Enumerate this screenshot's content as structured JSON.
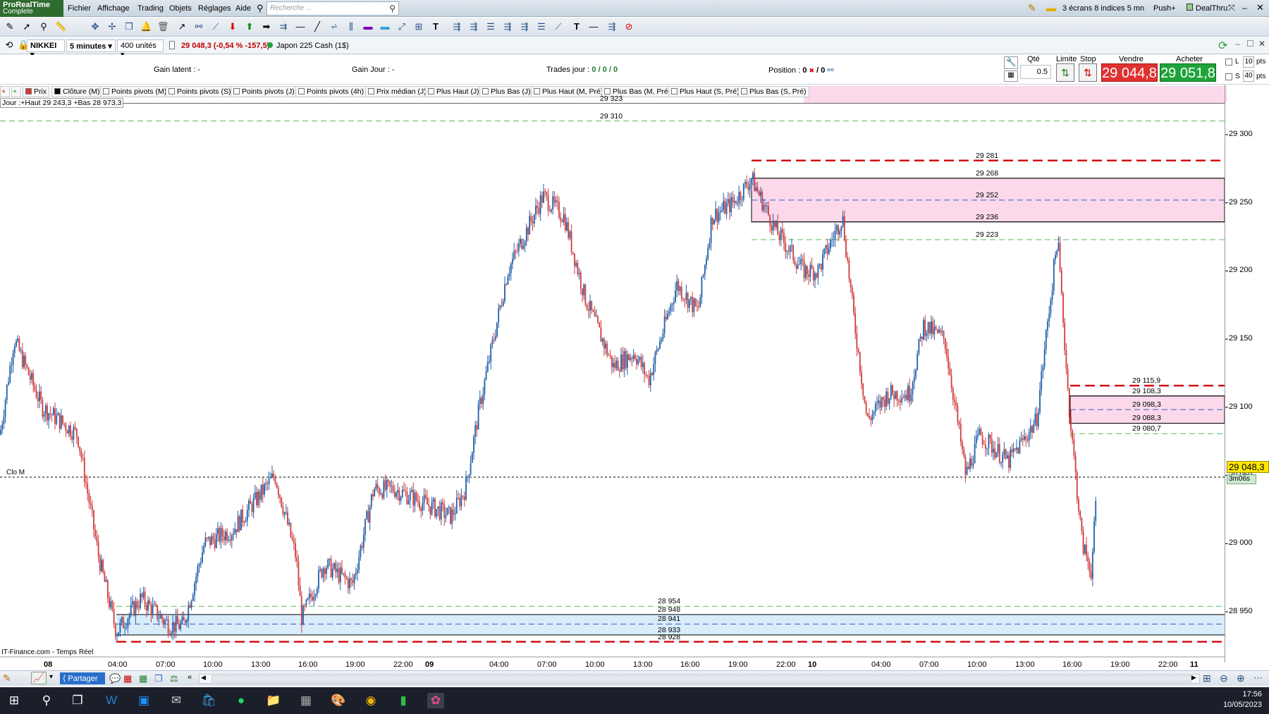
{
  "app": {
    "brand_line1": "ProRealTime",
    "brand_line2": "Complete"
  },
  "menu": [
    "Fichier",
    "Affichage",
    "Trading",
    "Objets",
    "Réglages",
    "Aide"
  ],
  "search": {
    "placeholder": "Recherche ..."
  },
  "top_right": {
    "layout": "3 écrans 8 indices 5 mn",
    "push": "Push+",
    "broker": "DealThru"
  },
  "instrument": {
    "symbol": "NIKKEI",
    "interval": "5 minutes",
    "units": "400 unités",
    "quote": "29 048,3 (-0,54 % -157,5)",
    "market": "Japon 225 Cash (1$)"
  },
  "info": {
    "gain_latent_label": "Gain latent :",
    "gain_latent_value": "-",
    "gain_jour_label": "Gain Jour :",
    "gain_jour_value": "-",
    "trades_label": "Trades jour :",
    "trades_value": "0 / 0 / 0",
    "position_label": "Position :",
    "position_value": "0",
    "position_sep": "/ 0"
  },
  "order_panel": {
    "qty_label": "Qté",
    "qty_value": "0.5",
    "limit_label": "Limite",
    "stop_label": "Stop",
    "sell_label": "Vendre",
    "sell_price": "29 044,8",
    "buy_label": "Acheter",
    "buy_price": "29 051,8",
    "l_label": "L",
    "l_value": "10",
    "s_label": "S",
    "s_value": "40",
    "pts": "pts"
  },
  "indicators": [
    "Prix",
    "Clôture (M)",
    "Points pivots (M)",
    "Points pivots (S)",
    "Points pivots (J)",
    "Points pivots (4h)",
    "Prix médian (J)",
    "Plus Haut (J)",
    "Plus Bas (J)",
    "Plus Haut (M, Pré)",
    "Plus Bas (M, Pré)",
    "Plus Haut (S, Pré)",
    "Plus Bas (S, Pré)"
  ],
  "day_label": "Jour :+Haut 29 243,3 +Bas 28 973,3",
  "chart_data": {
    "type": "candlestick",
    "y_axis": {
      "ticks": [
        "29 300",
        "29 250",
        "29 200",
        "29 150",
        "29 100",
        "29 050",
        "29 000",
        "28 950"
      ],
      "range": [
        28922,
        29325
      ]
    },
    "x_axis": {
      "ticks": [
        "08",
        "04:00",
        "07:00",
        "10:00",
        "13:00",
        "16:00",
        "19:00",
        "22:00",
        "09",
        "04:00",
        "07:00",
        "10:00",
        "13:00",
        "16:00",
        "19:00",
        "22:00",
        "10",
        "04:00",
        "07:00",
        "10:00",
        "13:00",
        "16:00",
        "19:00",
        "22:00",
        "11"
      ],
      "bold_ticks": [
        "08",
        "09",
        "10",
        "11"
      ]
    },
    "levels": [
      {
        "value": "29 323",
        "style": "gray"
      },
      {
        "value": "29 310",
        "style": "green-dashed"
      },
      {
        "value": "29 281",
        "style": "red-dashed"
      },
      {
        "value": "29 268",
        "style": "black"
      },
      {
        "value": "29 252",
        "style": "blue-dashed"
      },
      {
        "value": "29 236",
        "style": "black"
      },
      {
        "value": "29 223",
        "style": "green-dashed"
      },
      {
        "value": "29 115,9",
        "style": "red-dashed"
      },
      {
        "value": "29 108,3",
        "style": "black"
      },
      {
        "value": "29 098,3",
        "style": "blue-dashed"
      },
      {
        "value": "29 088,3",
        "style": "black"
      },
      {
        "value": "29 080,7",
        "style": "green-dashed"
      },
      {
        "value": "28 954",
        "style": "green-dashed"
      },
      {
        "value": "28 948",
        "style": "black"
      },
      {
        "value": "28 941",
        "style": "blue-dashed"
      },
      {
        "value": "28 933",
        "style": "black"
      },
      {
        "value": "28 928",
        "style": "red-dashed"
      }
    ],
    "close_line_label": "Clo M",
    "current_price": "29 048,3",
    "timer": "3m06s",
    "source": "IT-Finance.com - Temps Réel",
    "colors": {
      "up": "#1f5fa8",
      "down": "#d23a3a",
      "pink_zone": "#fbd9ea",
      "blue_zone": "#d8ecfa"
    }
  },
  "bottom": {
    "share": "Partager"
  },
  "clock": {
    "time": "17:56",
    "date": "10/05/2023"
  }
}
